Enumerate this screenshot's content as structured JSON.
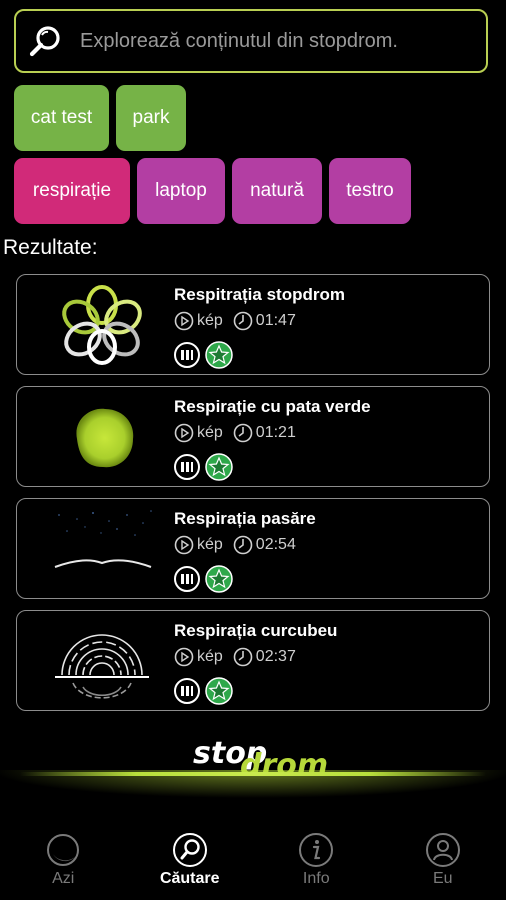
{
  "search": {
    "placeholder": "Explorează conținutul din stopdrom."
  },
  "tags": {
    "row1": [
      {
        "label": "cat test",
        "color": "#76b347"
      },
      {
        "label": "park",
        "color": "#76b347"
      }
    ],
    "row2": [
      {
        "label": "respirație",
        "color": "#d12a79"
      },
      {
        "label": "laptop",
        "color": "#b33ea3"
      },
      {
        "label": "natură",
        "color": "#b33ea3"
      },
      {
        "label": "testro",
        "color": "#b33ea3"
      }
    ]
  },
  "results_title": "Rezultate:",
  "results": [
    {
      "title": "Respitrația stopdrom",
      "type": "kép",
      "duration": "01:47",
      "thumbnail": "flower-icon"
    },
    {
      "title": "Respirație cu pata verde",
      "type": "kép",
      "duration": "01:21",
      "thumbnail": "green-blob-icon"
    },
    {
      "title": "Respirația pasăre",
      "type": "kép",
      "duration": "02:54",
      "thumbnail": "bird-icon"
    },
    {
      "title": "Respirația curcubeu",
      "type": "kép",
      "duration": "02:37",
      "thumbnail": "rainbow-icon"
    }
  ],
  "logo": {
    "part1": "stop",
    "part2": "drom"
  },
  "nav": [
    {
      "label": "Azi",
      "icon": "moon-icon"
    },
    {
      "label": "Căutare",
      "icon": "search-icon"
    },
    {
      "label": "Info",
      "icon": "info-icon"
    },
    {
      "label": "Eu",
      "icon": "user-icon"
    }
  ],
  "colors": {
    "accent": "#b9cf52",
    "tag_green": "#76b347",
    "tag_pink": "#d12a79",
    "tag_magenta": "#b33ea3",
    "badge_green": "#2ea84a"
  }
}
